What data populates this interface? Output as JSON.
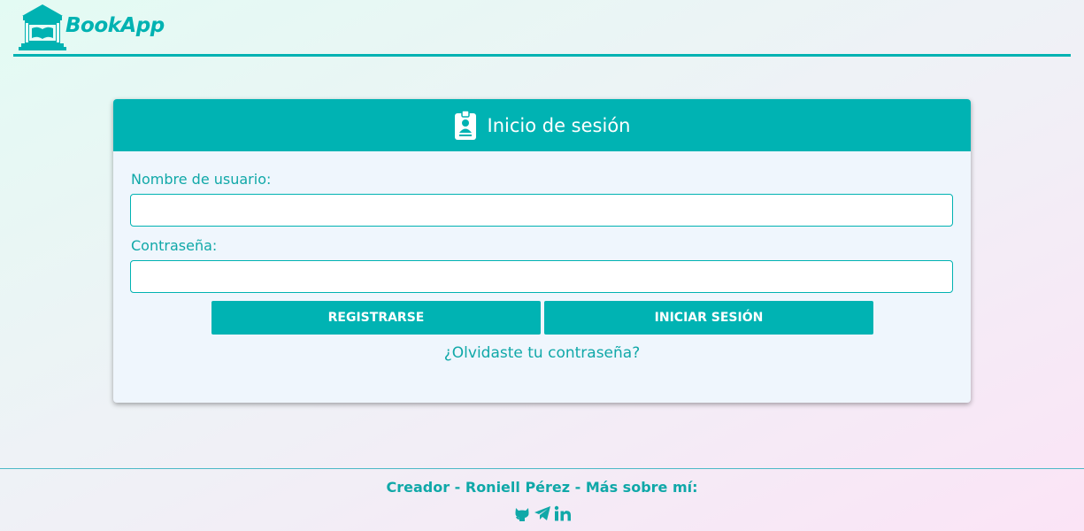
{
  "header": {
    "brand": "BookApp",
    "logo_icon": "library-book-icon"
  },
  "login": {
    "title": "Inicio de sesión",
    "title_icon": "id-badge-icon",
    "username_label": "Nombre de usuario:",
    "username_value": "",
    "password_label": "Contraseña:",
    "password_value": "",
    "register_label": "REGISTRARSE",
    "login_label": "INICIAR SESIÓN",
    "forgot_label": "¿Olvidaste tu contraseña?"
  },
  "footer": {
    "text": "Creador - Roniell Pérez - Más sobre mí:",
    "links": [
      "github-icon",
      "telegram-icon",
      "linkedin-icon"
    ]
  },
  "colors": {
    "accent": "#00b3b3",
    "card_bg": "#eff6fd",
    "white": "#ffffff"
  }
}
